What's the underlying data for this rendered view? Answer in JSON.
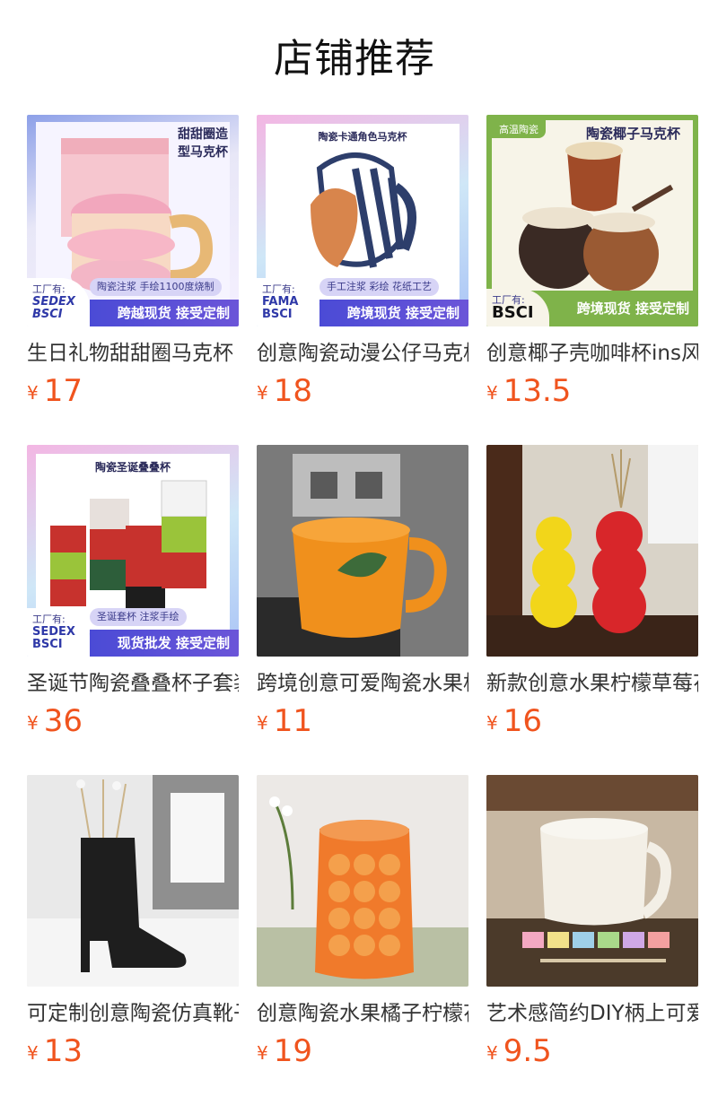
{
  "page": {
    "title": "店铺推荐"
  },
  "products": [
    {
      "name": "生日礼物甜甜圈马克杯",
      "price": "17",
      "currency": "¥",
      "image": {
        "banner_title_1": "甜甜圈造",
        "banner_title_2": "型马克杯",
        "pill": "陶瓷注浆 手绘1100度烧制",
        "badge_top": "工厂有:",
        "badge_1": "SEDEX",
        "badge_2": "BSCI",
        "bar": "跨越现货 接受定制"
      }
    },
    {
      "name": "创意陶瓷动漫公仔马克杯",
      "price": "18",
      "currency": "¥",
      "image": {
        "banner_title_1": "陶瓷卡通角色马克杯",
        "banner_title_2": "",
        "pill": "手工注浆 彩绘 花纸工艺",
        "badge_top": "工厂有:",
        "badge_1": "FAMA",
        "badge_2": "BSCI",
        "bar": "跨境现货 接受定制"
      }
    },
    {
      "name": "创意椰子壳咖啡杯ins风",
      "price": "13.5",
      "currency": "¥",
      "image": {
        "tag": "高温陶瓷",
        "banner_title_1": "陶瓷椰子马克杯",
        "banner_title_2": "",
        "pill": "",
        "badge_top": "工厂有:",
        "badge_1": "BSCI",
        "badge_2": "",
        "bar": "跨境现货 接受定制"
      }
    },
    {
      "name": "圣诞节陶瓷叠叠杯子套装",
      "price": "36",
      "currency": "¥",
      "image": {
        "banner_title_1": "陶瓷圣诞叠叠杯",
        "banner_title_2": "",
        "pill": "圣诞套杯 注浆手绘",
        "badge_top": "工厂有:",
        "badge_1": "SEDEX",
        "badge_2": "BSCI",
        "bar": "现货批发 接受定制"
      }
    },
    {
      "name": "跨境创意可爱陶瓷水果杯",
      "price": "11",
      "currency": "¥",
      "image": {}
    },
    {
      "name": "新款创意水果柠檬草莓花瓶",
      "price": "16",
      "currency": "¥",
      "image": {}
    },
    {
      "name": "可定制创意陶瓷仿真靴子花瓶",
      "price": "13",
      "currency": "¥",
      "image": {}
    },
    {
      "name": "创意陶瓷水果橘子柠檬花瓶",
      "price": "19",
      "currency": "¥",
      "image": {}
    },
    {
      "name": "艺术感简约DIY柄上可爱马克杯",
      "price": "9.5",
      "currency": "¥",
      "image": {}
    }
  ]
}
